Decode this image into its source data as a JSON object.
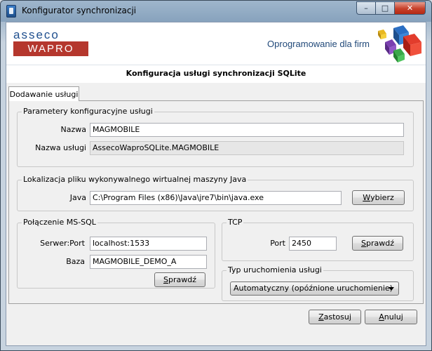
{
  "window": {
    "title": "Konfigurator synchronizacji",
    "controls": {
      "minimize": "–",
      "maximize": "□",
      "close": "✕"
    }
  },
  "banner": {
    "logo_top": "asseco",
    "logo_bottom": "WAPRO",
    "slogan": "Oprogramowanie dla firm"
  },
  "heading": "Konfiguracja usługi synchronizacji SQLite",
  "tabs": [
    {
      "label": "Dodawanie usługi",
      "active": true
    }
  ],
  "params": {
    "title": "Parametery konfiguracyjne usługi",
    "name_label": "Nazwa",
    "name_value": "MAGMOBILE",
    "service_label": "Nazwa usługi",
    "service_value": "AssecoWaproSQLite.MAGMOBILE"
  },
  "java": {
    "title": "Lokalizacja pliku wykonywalnego wirtualnej maszyny Java",
    "label": "Java",
    "value": "C:\\Program Files (x86)\\Java\\jre7\\bin\\java.exe",
    "browse_first": "W",
    "browse_rest": "ybierz"
  },
  "mssql": {
    "title": "Połączenie MS-SQL",
    "server_label": "Serwer:Port",
    "server_value": "localhost:1533",
    "db_label": "Baza",
    "db_value": "MAGMOBILE_DEMO_A",
    "check_first": "S",
    "check_rest": "prawdź"
  },
  "tcp": {
    "title": "TCP",
    "port_label": "Port",
    "port_value": "2450",
    "check_first": "S",
    "check_rest": "prawdź"
  },
  "startup": {
    "title": "Typ uruchomienia usługi",
    "selected": "Automatyczny (opóźnione uruchomienie)"
  },
  "footer": {
    "apply_first": "Z",
    "apply_rest": "astosuj",
    "cancel_first": "A",
    "cancel_rest": "nuluj"
  },
  "colors": {
    "brand_red": "#b5372d",
    "brand_blue": "#1f4f8e"
  }
}
